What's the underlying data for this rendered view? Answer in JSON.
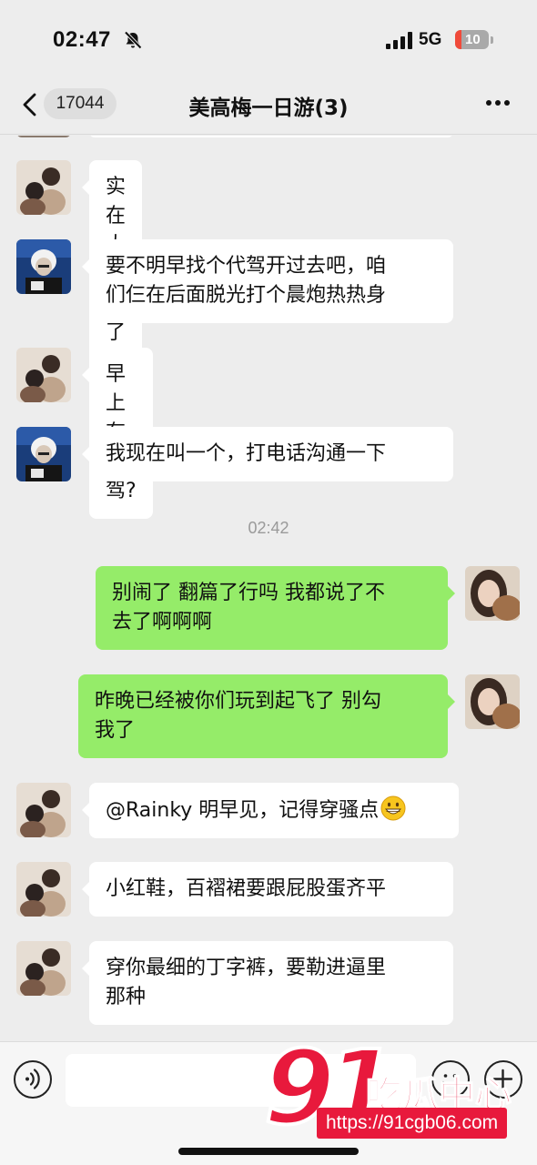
{
  "status_bar": {
    "time": "02:47",
    "network": "5G",
    "battery": "10"
  },
  "nav": {
    "unread_count": "17044",
    "title": "美高梅一日游(3)"
  },
  "messages": [
    {
      "side": "in",
      "sender": "friend-a",
      "lines": [
        "实在太极品了"
      ]
    },
    {
      "side": "in",
      "sender": "friend-b",
      "lines": [
        "要不明早找个代驾开过去吧，咱",
        "们仨在后面脱光打个晨炮热热身"
      ]
    },
    {
      "side": "in",
      "sender": "friend-a",
      "lines": [
        "早上有代驾?"
      ]
    },
    {
      "side": "in",
      "sender": "friend-b",
      "lines": [
        "我现在叫一个，打电话沟通一下"
      ]
    },
    {
      "side": "out",
      "sender": "me",
      "lines": [
        "别闹了 翻篇了行吗 我都说了不",
        "去了啊啊啊"
      ]
    },
    {
      "side": "out",
      "sender": "me",
      "lines": [
        "昨晚已经被你们玩到起飞了 别勾",
        "我了"
      ]
    },
    {
      "side": "in",
      "sender": "friend-a",
      "lines": [
        "@Rainky 明早见，记得穿骚点"
      ]
    },
    {
      "side": "in",
      "sender": "friend-a",
      "lines": [
        "小红鞋，百褶裙要跟屁股蛋齐平"
      ]
    },
    {
      "side": "in",
      "sender": "friend-a",
      "lines": [
        "穿你最细的丁字裤，要勒进逼里",
        "那种"
      ]
    }
  ],
  "timestamp": "02:42",
  "watermark": {
    "number": "91",
    "name": "吃瓜中心",
    "url": "https://91cgb06.com"
  },
  "colors": {
    "background": "#ededed",
    "bubble_out": "#95ec69",
    "bubble_in": "#ffffff",
    "watermark": "#e8193c"
  },
  "icons": [
    "mute-bell-icon",
    "signal-icon",
    "back-chevron-icon",
    "more-icon",
    "voice-icon",
    "emoji-icon",
    "plus-icon",
    "grinning-emoji-icon"
  ]
}
